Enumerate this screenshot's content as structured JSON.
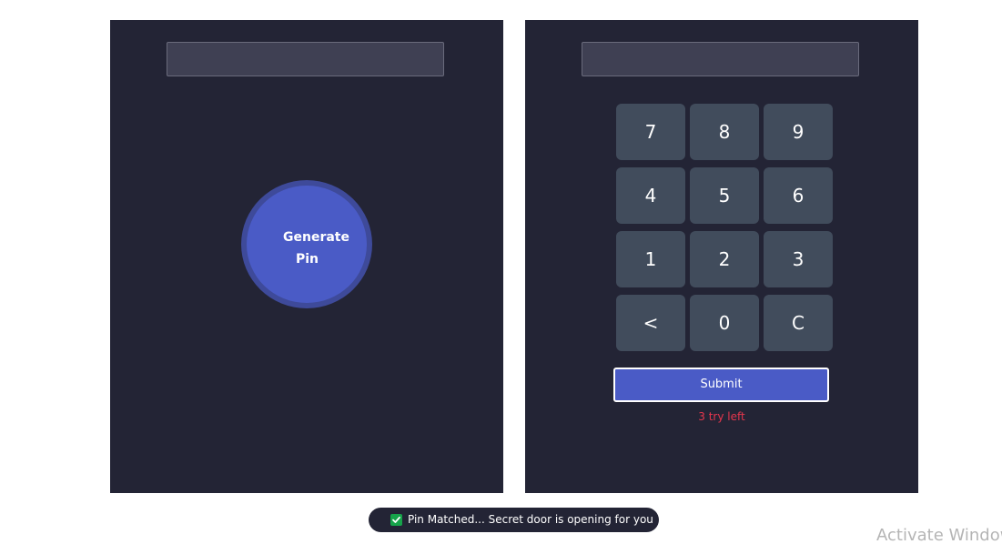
{
  "left_panel": {
    "generated_pin": "",
    "generate_button": {
      "line1": "Generate",
      "line2": "Pin"
    }
  },
  "right_panel": {
    "typed_pin": "",
    "keys": [
      "7",
      "8",
      "9",
      "4",
      "5",
      "6",
      "1",
      "2",
      "3",
      "<",
      "0",
      "C"
    ],
    "submit_label": "Submit",
    "tries_left": "3 try left"
  },
  "toast": {
    "icon": "check-box-icon",
    "message": "Pin Matched... Secret door is opening for you"
  },
  "watermark": "Activate Windows",
  "colors": {
    "panel_bg": "#232435",
    "accent": "#4a5bc6",
    "key_bg": "#414c5c",
    "error_text": "#e5364d",
    "success": "#16a34a"
  }
}
